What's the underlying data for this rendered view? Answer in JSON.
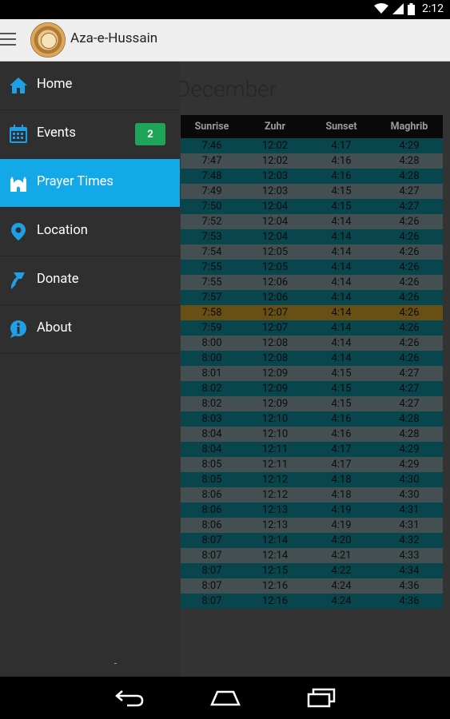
{
  "status_bar": {
    "time": "2:12"
  },
  "app_bar": {
    "title": "Aza-e-Hussain"
  },
  "prayer_times": {
    "month": "December",
    "columns": [
      "Sunrise",
      "Zuhr",
      "Sunset",
      "Maghrib"
    ],
    "rows": [
      [
        "7:46",
        "12:02",
        "4:17",
        "4:29"
      ],
      [
        "7:47",
        "12:02",
        "4:16",
        "4:28"
      ],
      [
        "7:48",
        "12:03",
        "4:16",
        "4:28"
      ],
      [
        "7:49",
        "12:03",
        "4:15",
        "4:27"
      ],
      [
        "7:50",
        "12:04",
        "4:15",
        "4:27"
      ],
      [
        "7:52",
        "12:04",
        "4:14",
        "4:26"
      ],
      [
        "7:53",
        "12:04",
        "4:14",
        "4:26"
      ],
      [
        "7:54",
        "12:05",
        "4:14",
        "4:26"
      ],
      [
        "7:55",
        "12:05",
        "4:14",
        "4:26"
      ],
      [
        "7:55",
        "12:06",
        "4:14",
        "4:26"
      ],
      [
        "7:57",
        "12:06",
        "4:14",
        "4:26"
      ],
      [
        "7:58",
        "12:07",
        "4:14",
        "4:26"
      ],
      [
        "7:59",
        "12:07",
        "4:14",
        "4:26"
      ],
      [
        "8:00",
        "12:08",
        "4:14",
        "4:26"
      ],
      [
        "8:00",
        "12:08",
        "4:14",
        "4:26"
      ],
      [
        "8:01",
        "12:09",
        "4:15",
        "4:27"
      ],
      [
        "8:02",
        "12:09",
        "4:15",
        "4:27"
      ],
      [
        "8:02",
        "12:09",
        "4:15",
        "4:27"
      ],
      [
        "8:03",
        "12:10",
        "4:16",
        "4:28"
      ],
      [
        "8:04",
        "12:10",
        "4:16",
        "4:28"
      ],
      [
        "8:04",
        "12:11",
        "4:17",
        "4:29"
      ],
      [
        "8:05",
        "12:11",
        "4:17",
        "4:29"
      ],
      [
        "8:05",
        "12:12",
        "4:18",
        "4:30"
      ],
      [
        "8:06",
        "12:12",
        "4:18",
        "4:30"
      ],
      [
        "8:06",
        "12:13",
        "4:19",
        "4:31"
      ],
      [
        "8:06",
        "12:13",
        "4:19",
        "4:31"
      ],
      [
        "8:07",
        "12:14",
        "4:20",
        "4:32"
      ],
      [
        "8:07",
        "12:14",
        "4:21",
        "4:33"
      ],
      [
        "8:07",
        "12:15",
        "4:22",
        "4:34"
      ],
      [
        "8:07",
        "12:16",
        "4:24",
        "4:36"
      ],
      [
        "8:07",
        "12:16",
        "4:24",
        "4:36"
      ]
    ],
    "highlighted_row": 11
  },
  "drawer": {
    "items": [
      {
        "label": "Home",
        "icon": "home-icon"
      },
      {
        "label": "Events",
        "icon": "calendar-icon",
        "badge": "2"
      },
      {
        "label": "Prayer Times",
        "icon": "mosque-icon",
        "active": true
      },
      {
        "label": "Location",
        "icon": "location-pin-icon"
      },
      {
        "label": "Donate",
        "icon": "donate-icon"
      },
      {
        "label": "About",
        "icon": "info-icon"
      }
    ]
  },
  "colors": {
    "accent": "#13a8e8",
    "badge": "#1fa55a",
    "row_teal": "#0d5c66",
    "row_grey": "#5b6a6d",
    "row_today": "#8a6a1c"
  }
}
